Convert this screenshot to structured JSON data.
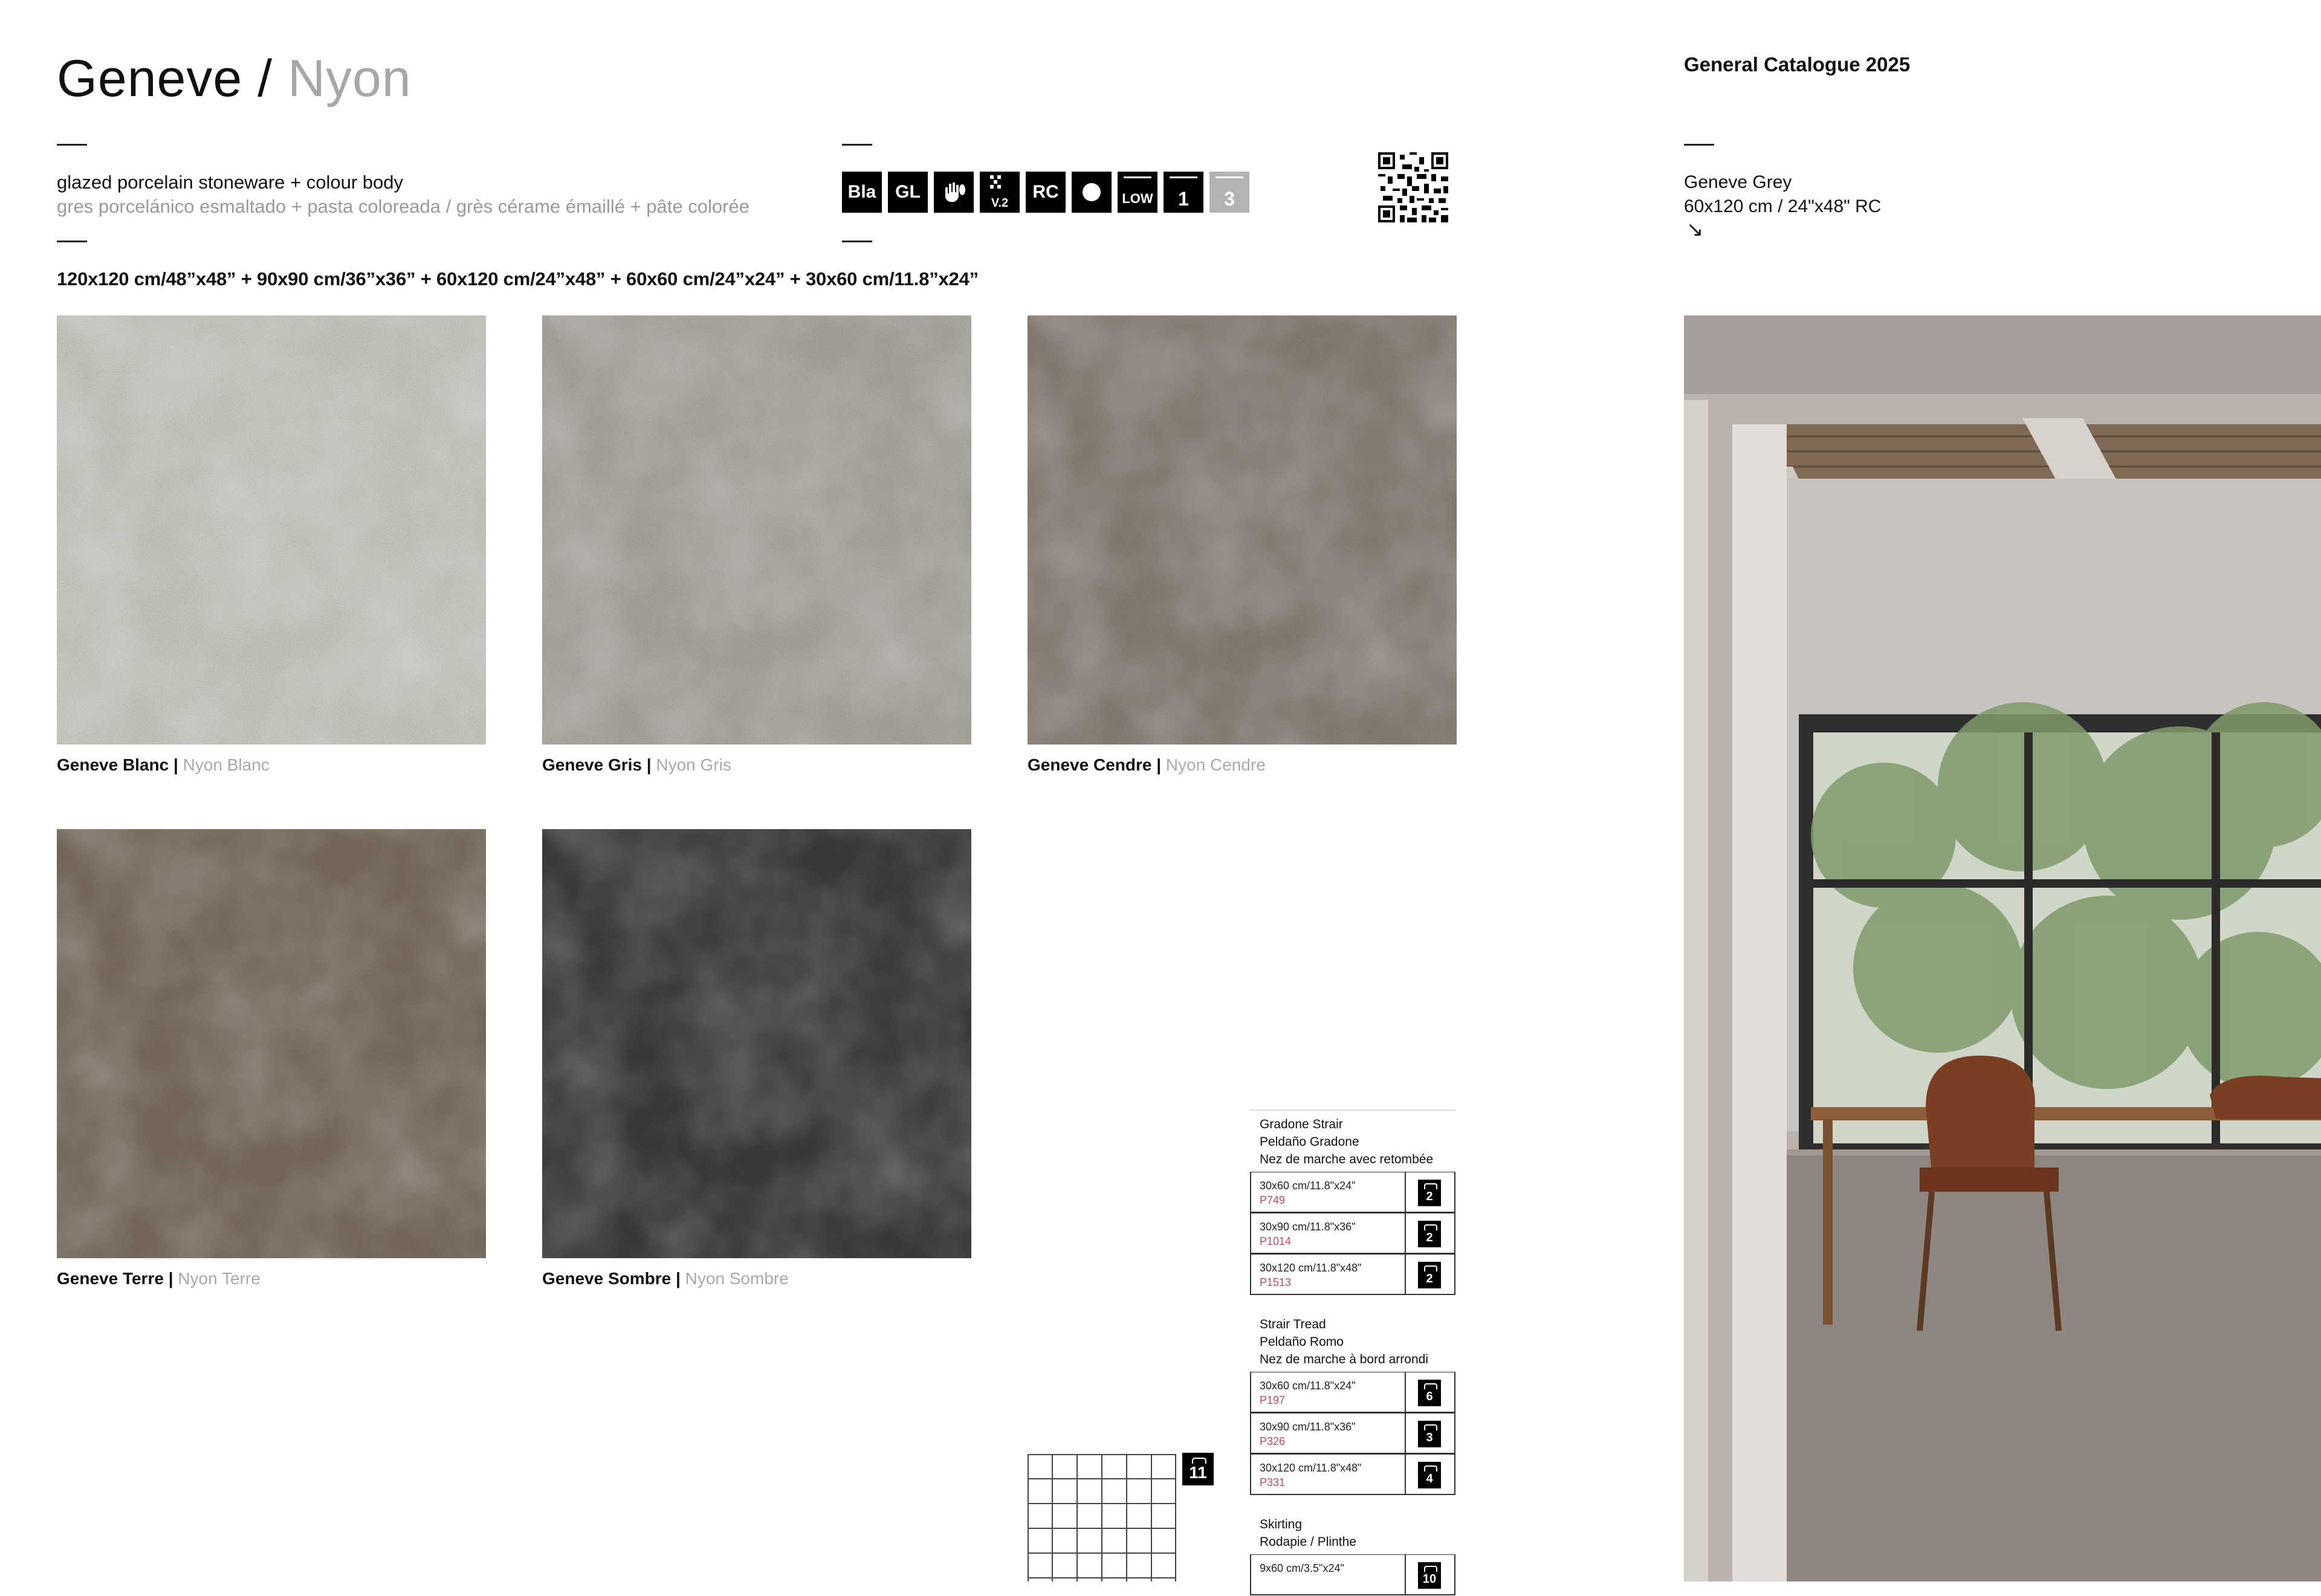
{
  "header": {
    "title_main": "Geneve",
    "title_sep": "/",
    "title_alt": "Nyon",
    "catalog": "General Catalogue 2025"
  },
  "description": {
    "en": "glazed porcelain stoneware + colour body",
    "es_fr": "gres porcelánico esmaltado + pasta coloreada / grès cérame émaillé + pâte colorée",
    "sizes": "120x120 cm/48”x48” + 90x90 cm/36”x36” + 60x120 cm/24”x48” + 60x60 cm/24”x24” + 30x60 cm/11.8”x24”"
  },
  "icons": [
    {
      "name": "bla-icon",
      "label": "Bla"
    },
    {
      "name": "gl-icon",
      "label": "GL"
    },
    {
      "name": "hand-icon",
      "label": ""
    },
    {
      "name": "v2-icon",
      "label": "V.2"
    },
    {
      "name": "rc-icon",
      "label": "RC"
    },
    {
      "name": "dot-icon",
      "label": ""
    },
    {
      "name": "low-icon",
      "label": "LOW"
    },
    {
      "name": "one-icon",
      "label": "1"
    },
    {
      "name": "three-icon",
      "label": "3"
    }
  ],
  "featured": {
    "name": "Geneve Grey",
    "size": "60x120 cm / 24\"x48\" RC",
    "arrow": "↘"
  },
  "swatches": [
    {
      "name": "Geneve Blanc",
      "alt": "Nyon Blanc",
      "color": "#dcdbd3"
    },
    {
      "name": "Geneve Gris",
      "alt": "Nyon Gris",
      "color": "#bab5ae"
    },
    {
      "name": "Geneve Cendre",
      "alt": "Nyon Cendre",
      "color": "#958b81"
    },
    {
      "name": "Geneve Terre",
      "alt": "Nyon Terre",
      "color": "#857667"
    },
    {
      "name": "Geneve Sombre",
      "alt": "Nyon Sombre",
      "color": "#434242"
    }
  ],
  "separator": "|",
  "trims": [
    {
      "head": [
        "Gradone Strair",
        "Peldaño Gradone",
        "Nez de marche avec retombée"
      ],
      "rows": [
        {
          "size": "30x60 cm/11.8\"x24\"",
          "code": "P749",
          "pieces": "2"
        },
        {
          "size": "30x90 cm/11.8\"x36\"",
          "code": "P1014",
          "pieces": "2"
        },
        {
          "size": "30x120 cm/11.8\"x48\"",
          "code": "P1513",
          "pieces": "2"
        }
      ]
    },
    {
      "head": [
        "Strair Tread",
        "Peldaño Romo",
        "Nez de marche à bord arrondi"
      ],
      "rows": [
        {
          "size": "30x60 cm/11.8\"x24\"",
          "code": "P197",
          "pieces": "6"
        },
        {
          "size": "30x90 cm/11.8\"x36\"",
          "code": "P326",
          "pieces": "3"
        },
        {
          "size": "30x120 cm/11.8\"x48\"",
          "code": "P331",
          "pieces": "4"
        }
      ]
    },
    {
      "head": [
        "Skirting",
        "Rodapie / Plinthe"
      ],
      "rows": [
        {
          "size": "9x60 cm/3.5\"x24\"",
          "code": "",
          "pieces": "10"
        }
      ]
    }
  ],
  "mosaic_badge": "11"
}
